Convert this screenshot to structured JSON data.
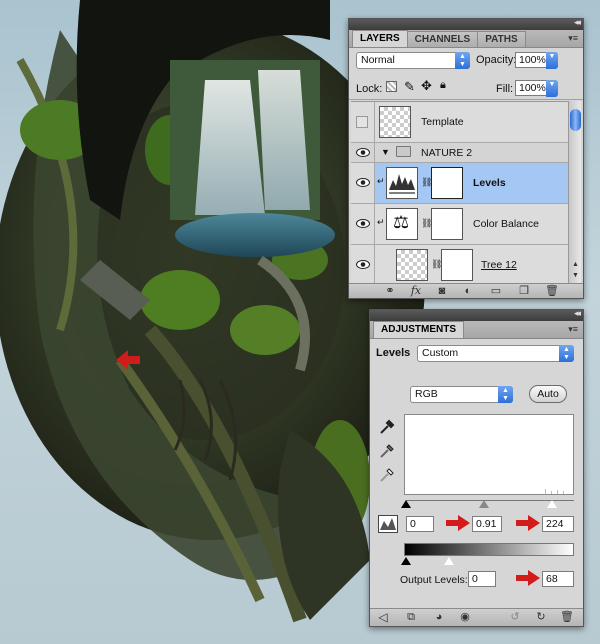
{
  "layers_panel": {
    "tabs": [
      {
        "label": "LAYERS",
        "active": true
      },
      {
        "label": "CHANNELS",
        "active": false
      },
      {
        "label": "PATHS",
        "active": false
      }
    ],
    "blend_mode": "Normal",
    "opacity_label": "Opacity:",
    "opacity_value": "100%",
    "lock_label": "Lock:",
    "fill_label": "Fill:",
    "fill_value": "100%",
    "layers": [
      {
        "name": "Template",
        "visible": false,
        "type": "layer"
      },
      {
        "name": "NATURE 2",
        "visible": true,
        "type": "group"
      },
      {
        "name": "Levels",
        "visible": true,
        "type": "adjustment-levels",
        "selected": true
      },
      {
        "name": "Color Balance",
        "visible": true,
        "type": "adjustment-color-balance"
      },
      {
        "name": "Tree 12",
        "visible": true,
        "type": "layer-with-mask"
      }
    ],
    "footer_icons": [
      "link-icon",
      "fx-icon",
      "mask-icon",
      "adjustment-layer-icon",
      "new-group-icon",
      "new-layer-icon",
      "trash-icon"
    ]
  },
  "adjustments_panel": {
    "tab_label": "ADJUSTMENTS",
    "adjustment_type": "Levels",
    "preset": "Custom",
    "channel": "RGB",
    "auto_label": "Auto",
    "input_black": "0",
    "input_gamma": "0.91",
    "input_white": "224",
    "output_label": "Output Levels:",
    "output_black": "0",
    "output_white": "68",
    "footer_icons": [
      "back-arrow-icon",
      "expand-view-icon",
      "clip-icon",
      "visibility-icon",
      "previous-state-icon",
      "reset-icon",
      "trash-icon"
    ]
  },
  "colors": {
    "selection": "#a5c7f3",
    "accent_blue": "#2e6fd8",
    "annotation_red": "#d21b1b"
  }
}
